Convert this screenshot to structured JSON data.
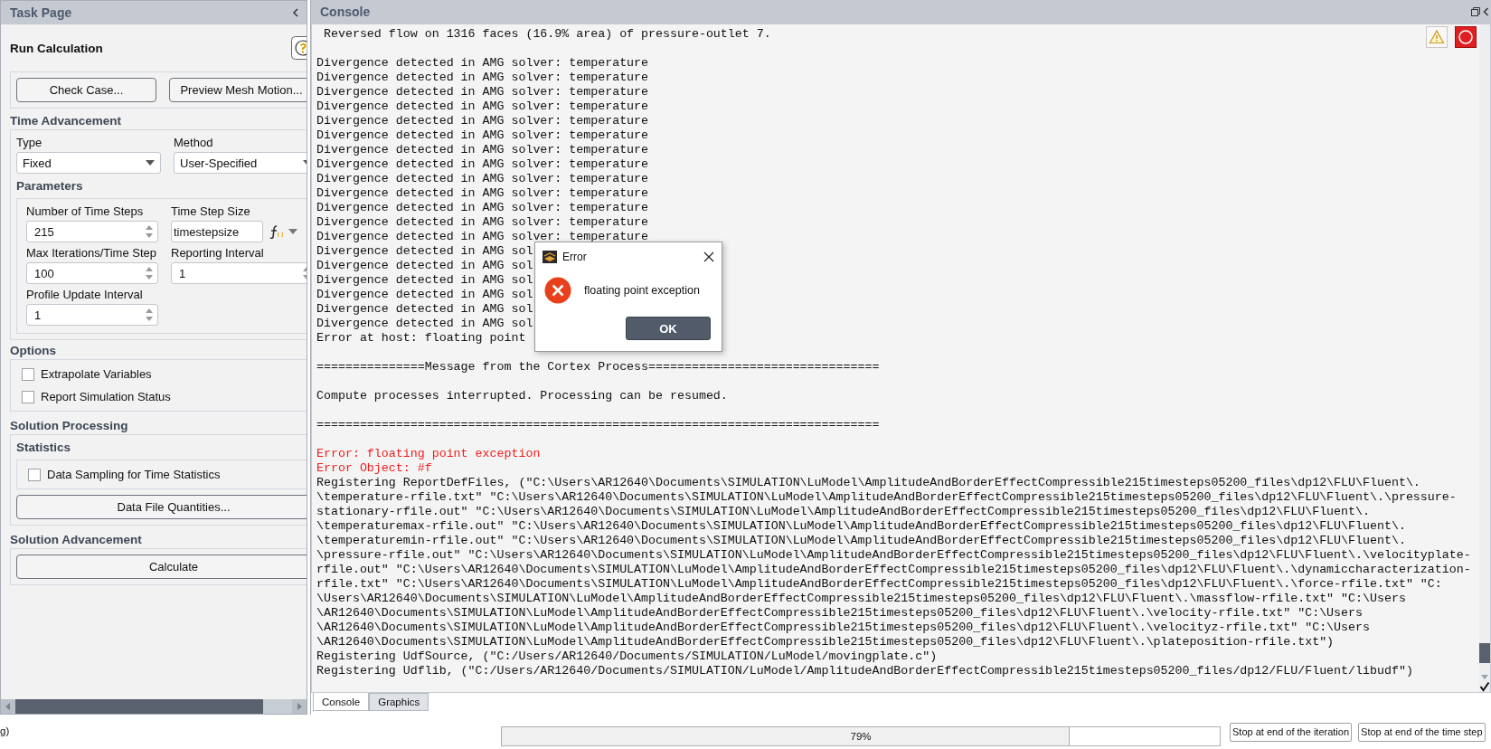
{
  "task_page": {
    "title": "Task Page",
    "run_calculation": {
      "title": "Run Calculation",
      "buttons": [
        "Check Case...",
        "Preview Mesh Motion..."
      ]
    },
    "time_advancement": {
      "title": "Time Advancement",
      "type": {
        "label": "Type",
        "value": "Fixed"
      },
      "method": {
        "label": "Method",
        "value": "User-Specified"
      }
    },
    "parameters": {
      "title": "Parameters",
      "fields": [
        {
          "label": "Number of Time Steps",
          "value": "215",
          "kind": "spin"
        },
        {
          "label": "Time Step Size",
          "value": "timestepsize",
          "kind": "expression"
        },
        {
          "label": "Max Iterations/Time Step",
          "value": "100",
          "kind": "spin"
        },
        {
          "label": "Reporting Interval",
          "value": "1",
          "kind": "spin"
        },
        {
          "label": "Profile Update Interval",
          "value": "1",
          "kind": "spin"
        }
      ]
    },
    "options": {
      "title": "Options",
      "checkboxes": [
        {
          "label": "Extrapolate Variables",
          "checked": false
        },
        {
          "label": "Report Simulation Status",
          "checked": false
        }
      ]
    },
    "solution_processing": {
      "title": "Solution Processing",
      "statistics": {
        "title": "Statistics",
        "checkboxes": [
          {
            "label": "Data Sampling for Time Statistics",
            "checked": false
          }
        ]
      },
      "button": "Data File Quantities..."
    },
    "solution_advancement": {
      "title": "Solution Advancement",
      "button": "Calculate"
    }
  },
  "console": {
    "title": "Console",
    "lines": [
      {
        "kind": "normal",
        "text": " Reversed flow on 1316 faces (16.9% area) of pressure-outlet 7."
      },
      {
        "kind": "blank"
      },
      {
        "kind": "normal",
        "text": "Divergence detected in AMG solver: temperature"
      },
      {
        "kind": "normal",
        "text": "Divergence detected in AMG solver: temperature"
      },
      {
        "kind": "normal",
        "text": "Divergence detected in AMG solver: temperature"
      },
      {
        "kind": "normal",
        "text": "Divergence detected in AMG solver: temperature"
      },
      {
        "kind": "normal",
        "text": "Divergence detected in AMG solver: temperature"
      },
      {
        "kind": "normal",
        "text": "Divergence detected in AMG solver: temperature"
      },
      {
        "kind": "normal",
        "text": "Divergence detected in AMG solver: temperature"
      },
      {
        "kind": "normal",
        "text": "Divergence detected in AMG solver: temperature"
      },
      {
        "kind": "normal",
        "text": "Divergence detected in AMG solver: temperature"
      },
      {
        "kind": "normal",
        "text": "Divergence detected in AMG solver: temperature"
      },
      {
        "kind": "normal",
        "text": "Divergence detected in AMG solver: temperature"
      },
      {
        "kind": "normal",
        "text": "Divergence detected in AMG solver: temperature"
      },
      {
        "kind": "normal",
        "text": "Divergence detected in AMG solver: temperature"
      },
      {
        "kind": "normal",
        "text": "Divergence detected in AMG sol"
      },
      {
        "kind": "normal",
        "text": "Divergence detected in AMG sol"
      },
      {
        "kind": "normal",
        "text": "Divergence detected in AMG sol"
      },
      {
        "kind": "normal",
        "text": "Divergence detected in AMG sol"
      },
      {
        "kind": "normal",
        "text": "Divergence detected in AMG sol"
      },
      {
        "kind": "normal",
        "text": "Divergence detected in AMG sol"
      },
      {
        "kind": "normal",
        "text": "Error at host: floating point"
      },
      {
        "kind": "blank"
      },
      {
        "kind": "normal",
        "text": "===============Message from the Cortex Process================================"
      },
      {
        "kind": "blank"
      },
      {
        "kind": "normal",
        "text": "Compute processes interrupted. Processing can be resumed."
      },
      {
        "kind": "blank"
      },
      {
        "kind": "normal",
        "text": "=============================================================================="
      },
      {
        "kind": "blank"
      },
      {
        "kind": "error",
        "text": "Error: floating point exception"
      },
      {
        "kind": "error",
        "text": "Error Object: #f"
      },
      {
        "kind": "normal",
        "text": "Registering ReportDefFiles, (\"C:\\Users\\AR12640\\Documents\\SIMULATION\\LuModel\\AmplitudeAndBorderEffectCompressible215timesteps05200_files\\dp12\\FLU\\Fluent\\."
      },
      {
        "kind": "normal",
        "text": "\\temperature-rfile.txt\" \"C:\\Users\\AR12640\\Documents\\SIMULATION\\LuModel\\AmplitudeAndBorderEffectCompressible215timesteps05200_files\\dp12\\FLU\\Fluent\\.\\pressure-"
      },
      {
        "kind": "normal",
        "text": "stationary-rfile.out\" \"C:\\Users\\AR12640\\Documents\\SIMULATION\\LuModel\\AmplitudeAndBorderEffectCompressible215timesteps05200_files\\dp12\\FLU\\Fluent\\."
      },
      {
        "kind": "normal",
        "text": "\\temperaturemax-rfile.out\" \"C:\\Users\\AR12640\\Documents\\SIMULATION\\LuModel\\AmplitudeAndBorderEffectCompressible215timesteps05200_files\\dp12\\FLU\\Fluent\\."
      },
      {
        "kind": "normal",
        "text": "\\temperaturemin-rfile.out\" \"C:\\Users\\AR12640\\Documents\\SIMULATION\\LuModel\\AmplitudeAndBorderEffectCompressible215timesteps05200_files\\dp12\\FLU\\Fluent\\."
      },
      {
        "kind": "normal",
        "text": "\\pressure-rfile.out\" \"C:\\Users\\AR12640\\Documents\\SIMULATION\\LuModel\\AmplitudeAndBorderEffectCompressible215timesteps05200_files\\dp12\\FLU\\Fluent\\.\\velocityplate-"
      },
      {
        "kind": "normal",
        "text": "rfile.out\" \"C:\\Users\\AR12640\\Documents\\SIMULATION\\LuModel\\AmplitudeAndBorderEffectCompressible215timesteps05200_files\\dp12\\FLU\\Fluent\\.\\dynamiccharacterization-"
      },
      {
        "kind": "normal",
        "text": "rfile.txt\" \"C:\\Users\\AR12640\\Documents\\SIMULATION\\LuModel\\AmplitudeAndBorderEffectCompressible215timesteps05200_files\\dp12\\FLU\\Fluent\\.\\force-rfile.txt\" \"C:"
      },
      {
        "kind": "normal",
        "text": "\\Users\\AR12640\\Documents\\SIMULATION\\LuModel\\AmplitudeAndBorderEffectCompressible215timesteps05200_files\\dp12\\FLU\\Fluent\\.\\massflow-rfile.txt\" \"C:\\Users"
      },
      {
        "kind": "normal",
        "text": "\\AR12640\\Documents\\SIMULATION\\LuModel\\AmplitudeAndBorderEffectCompressible215timesteps05200_files\\dp12\\FLU\\Fluent\\.\\velocity-rfile.txt\" \"C:\\Users"
      },
      {
        "kind": "normal",
        "text": "\\AR12640\\Documents\\SIMULATION\\LuModel\\AmplitudeAndBorderEffectCompressible215timesteps05200_files\\dp12\\FLU\\Fluent\\.\\velocityz-rfile.txt\" \"C:\\Users"
      },
      {
        "kind": "normal",
        "text": "\\AR12640\\Documents\\SIMULATION\\LuModel\\AmplitudeAndBorderEffectCompressible215timesteps05200_files\\dp12\\FLU\\Fluent\\.\\plateposition-rfile.txt\")"
      },
      {
        "kind": "normal",
        "text": "Registering UdfSource, (\"C:/Users/AR12640/Documents/SIMULATION/LuModel/movingplate.c\")"
      },
      {
        "kind": "normal",
        "text": "Registering Udflib, (\"C:/Users/AR12640/Documents/SIMULATION/LuModel/AmplitudeAndBorderEffectCompressible215timesteps05200_files/dp12/FLU/Fluent/libudf\")"
      }
    ],
    "tabs": [
      {
        "label": "Console",
        "selected": true
      },
      {
        "label": "Graphics",
        "selected": false
      }
    ]
  },
  "dialog": {
    "title": "Error",
    "message": "floating point exception",
    "button": "OK"
  },
  "status_bar": {
    "text": "g)",
    "progress": {
      "label": "79%",
      "level": 0.79
    },
    "buttons": [
      "Stop at end of the iteration",
      "Stop at end of the time step"
    ]
  }
}
